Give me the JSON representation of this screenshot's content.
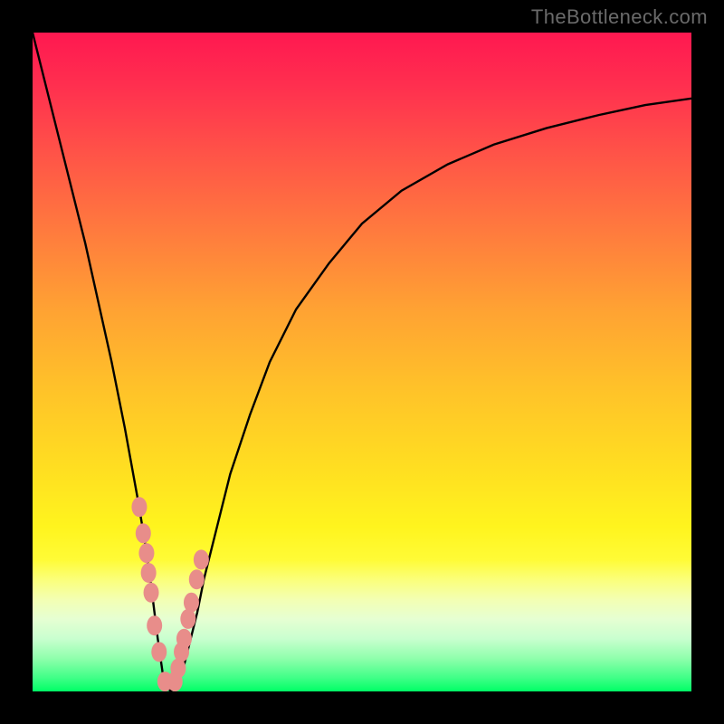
{
  "watermark": "TheBottleneck.com",
  "colors": {
    "frame": "#000000",
    "curve": "#000000",
    "dot": "#e88d8a",
    "grad_top": "#ff1850",
    "grad_bottom": "#00ff66"
  },
  "chart_data": {
    "type": "line",
    "title": "",
    "xlabel": "",
    "ylabel": "",
    "xlim": [
      0,
      100
    ],
    "ylim": [
      0,
      100
    ],
    "x": [
      0,
      2,
      4,
      6,
      8,
      10,
      12,
      14,
      16,
      17,
      18,
      19,
      20,
      21,
      22,
      23,
      24,
      25,
      26,
      28,
      30,
      33,
      36,
      40,
      45,
      50,
      56,
      63,
      70,
      78,
      86,
      93,
      100
    ],
    "y": [
      100,
      92,
      84,
      76,
      68,
      59,
      50,
      40,
      29,
      23,
      16,
      8,
      1,
      0,
      1,
      4,
      8,
      12,
      17,
      25,
      33,
      42,
      50,
      58,
      65,
      71,
      76,
      80,
      83,
      85.5,
      87.5,
      89,
      90
    ],
    "notes": "V-shaped bottleneck curve. x-axis is relative component performance (0-100); y-axis is bottleneck percentage (0-100). Minimum (0% bottleneck, green zone) occurs near x≈21. Left branch is steep/near-linear, right branch rises asymptotically toward ~90%. No axis ticks or labels are rendered.",
    "series": [
      {
        "name": "sample_points_left",
        "x": [
          16.2,
          16.8,
          17.3,
          17.6,
          18.0,
          18.5,
          19.2,
          20.1
        ],
        "y": [
          28,
          24,
          21,
          18,
          15,
          10,
          6,
          1.5
        ]
      },
      {
        "name": "sample_points_right",
        "x": [
          21.6,
          22.1,
          22.6,
          23.0,
          23.6,
          24.1,
          24.9,
          25.6
        ],
        "y": [
          1.5,
          3.5,
          6,
          8,
          11,
          13.5,
          17,
          20
        ]
      }
    ]
  }
}
